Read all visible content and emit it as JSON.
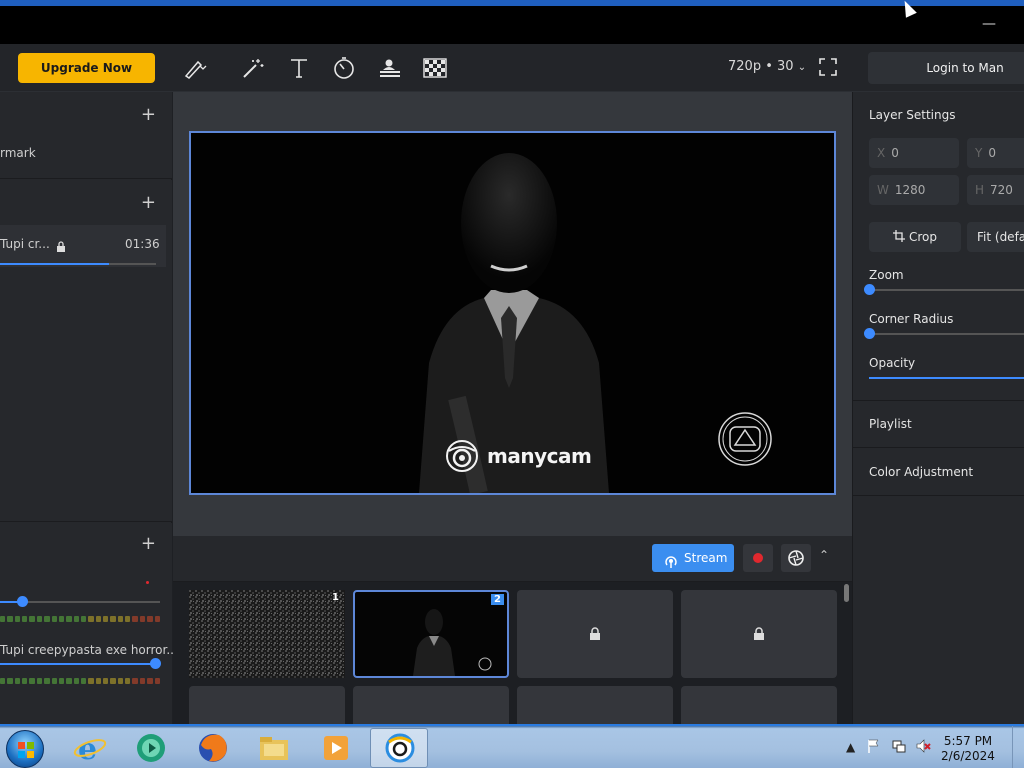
{
  "toolbar": {
    "upgrade_label": "Upgrade Now",
    "resolution": "720p • 30",
    "login_label": "Login to Man"
  },
  "left_panel": {
    "watermark_label": "rmark",
    "media_item": {
      "title": "Tupi cr...",
      "duration": "01:36",
      "progress": 0.7
    },
    "audio_item_title": "Tupi creepypasta exe horror...",
    "audio_level_1": 0.14,
    "audio_level_2": 0.97
  },
  "preview": {
    "brand_name": "manycam"
  },
  "stream_bar": {
    "stream_label": "Stream"
  },
  "scenes": {
    "tiles": [
      {
        "badge": "1",
        "state": "noise"
      },
      {
        "badge": "2",
        "state": "active"
      },
      {
        "badge": "",
        "state": "locked"
      },
      {
        "badge": "",
        "state": "locked"
      }
    ]
  },
  "right_panel": {
    "title": "Layer Settings",
    "x_prefix": "X",
    "x_value": "0",
    "y_prefix": "Y",
    "y_value": "0",
    "w_prefix": "W",
    "w_value": "1280",
    "h_prefix": "H",
    "h_value": "720",
    "crop_label": "Crop",
    "fit_label": "Fit (defau",
    "zoom_label": "Zoom",
    "zoom_value": 0,
    "corner_radius_label": "Corner Radius",
    "corner_radius_value": 0,
    "opacity_label": "Opacity",
    "opacity_value": 1,
    "playlist_label": "Playlist",
    "color_adjustment_label": "Color Adjustment"
  },
  "taskbar": {
    "time": "5:57 PM",
    "date": "2/6/2024"
  },
  "colors": {
    "accent": "#3b8ef0",
    "upgrade": "#f7b500",
    "record": "#e0282e"
  }
}
